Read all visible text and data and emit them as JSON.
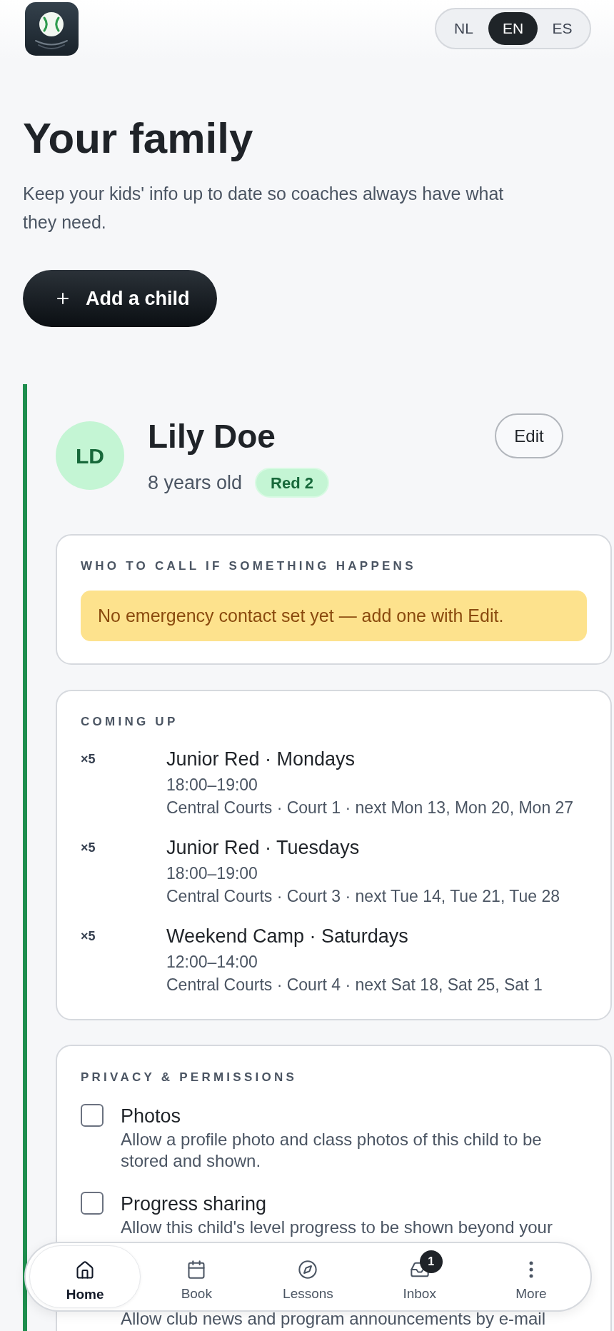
{
  "header": {
    "language_switch": [
      {
        "label": "NL",
        "selected": false
      },
      {
        "label": "EN",
        "selected": true
      },
      {
        "label": "ES",
        "selected": false
      }
    ]
  },
  "page": {
    "title": "Your family",
    "subtitle": "Keep your kids' info up to date so coaches always have what they need.",
    "add_button": "Add a child"
  },
  "children": [
    {
      "initials": "LD",
      "name": "Lily Doe",
      "age": "8 years old",
      "badge": "Red 2",
      "edit_button": "Edit",
      "emergency": {
        "heading": "WHO TO CALL IF SOMETHING HAPPENS",
        "notice": "No emergency contact set yet — add one with Edit."
      },
      "coming_up": {
        "heading": "COMING UP",
        "items": [
          {
            "count": "×5",
            "title": "Junior Red · Mondays",
            "time": "18:00–19:00",
            "location": "Central Courts · Court 1 · next Mon 13, Mon 20, Mon 27"
          },
          {
            "count": "×5",
            "title": "Junior Red · Tuesdays",
            "time": "18:00–19:00",
            "location": "Central Courts · Court 3 · next Tue 14, Tue 21, Tue 28"
          },
          {
            "count": "×5",
            "title": "Weekend Camp · Saturdays",
            "time": "12:00–14:00",
            "location": "Central Courts · Court 4 · next Sat 18, Sat 25, Sat 1"
          }
        ]
      },
      "privacy": {
        "heading": "PRIVACY & PERMISSIONS",
        "items": [
          {
            "title": "Photos",
            "description": "Allow a profile photo and class photos of this child to be stored and shown.",
            "checked": false
          },
          {
            "title": "Progress sharing",
            "description": "Allow this child's level progress to be shown beyond your",
            "checked": false
          },
          {
            "description": "Allow club news and program announcements by e-mail"
          }
        ]
      }
    }
  ],
  "nav": [
    {
      "label": "Home",
      "selected": true
    },
    {
      "label": "Book",
      "selected": false
    },
    {
      "label": "Lessons",
      "selected": false
    },
    {
      "label": "Inbox",
      "selected": false,
      "badge": "1"
    },
    {
      "label": "More",
      "selected": false
    }
  ]
}
